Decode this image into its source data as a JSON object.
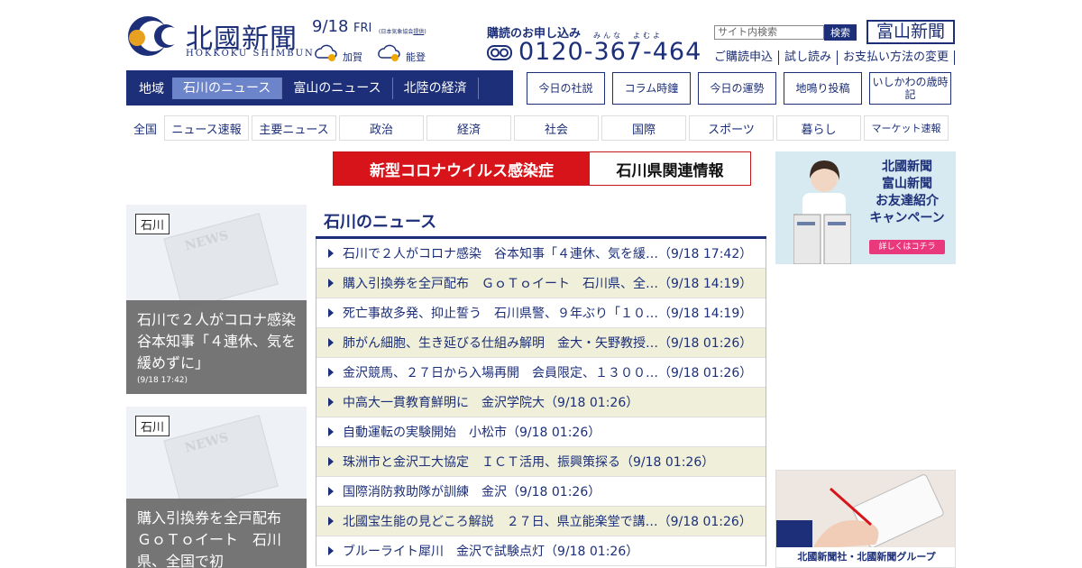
{
  "header": {
    "logo_jp": "北國新聞",
    "logo_en": "HOKKOKU SHIMBUN",
    "date": "9/18",
    "day_of_week": "FRI",
    "weather_source_prefix": "(日本気象協会",
    "weather_source_link": "提供",
    "weather_source_suffix": ")",
    "weather": [
      {
        "area": "加賀",
        "icon": "cloudy-sunny-icon"
      },
      {
        "area": "能登",
        "icon": "cloudy-sunny-icon"
      }
    ],
    "subscribe_title": "購読のお申し込み",
    "phone_ruby": "みんな　よむよ",
    "phone": "0120-367-464",
    "search_placeholder": "サイト内検索",
    "search_button": "検索",
    "toyama_logo": "富山新聞",
    "sublinks": [
      "ご購読申込",
      "試し読み",
      "お支払い方法の変更"
    ]
  },
  "region_nav": {
    "label": "地域",
    "tabs": [
      "石川のニュース",
      "富山のニュース",
      "北陸の経済"
    ],
    "active": 0
  },
  "feature_nav": [
    "今日の社説",
    "コラム時鐘",
    "今日の運勢",
    "地鳴り投稿",
    "いしかわの歳時記"
  ],
  "category_nav": {
    "label": "全国",
    "items": [
      "ニュース速報",
      "主要ニュース",
      "政治",
      "経済",
      "社会",
      "国際",
      "スポーツ",
      "暮らし",
      "マーケット速報"
    ]
  },
  "corona_banner": {
    "left": "新型コロナウイルス感染症",
    "right": "石川県関連情報"
  },
  "cards": [
    {
      "tag": "石川",
      "title": "石川で２人がコロナ感染　谷本知事「４連休、気を緩めずに」",
      "date": "(9/18 17:42)"
    },
    {
      "tag": "石川",
      "title": "購入引換券を全戸配布　ＧｏＴｏイート　石川県、全国で初",
      "date": ""
    }
  ],
  "card_watermark": "NEWS",
  "news_section": {
    "heading": "石川のニュース",
    "items": [
      "石川で２人がコロナ感染　谷本知事「４連休、気を緩…（9/18 17:42）",
      "購入引換券を全戸配布　ＧｏＴｏイート　石川県、全…（9/18 14:19）",
      "死亡事故多発、抑止誓う　石川県警、９年ぶり「１０…（9/18 14:19）",
      "肺がん細胞、生き延びる仕組み解明　金大・矢野教授…（9/18 01:26）",
      "金沢競馬、２７日から入場再開　会員限定、１３００…（9/18 01:26）",
      "中高大一貫教育鮮明に　金沢学院大（9/18 01:26）",
      "自動運転の実験開始　小松市（9/18 01:26）",
      "珠洲市と金沢工大協定　ＩＣＴ活用、振興策探る（9/18 01:26）",
      "国際消防救助隊が訓練　金沢（9/18 01:26）",
      "北國宝生能の見どころ解説　２７日、県立能楽堂で講…（9/18 01:26）",
      "ブルーライト犀川　金沢で試験点灯（9/18 01:26）"
    ]
  },
  "ads": {
    "campaign_line1": "北國新聞",
    "campaign_line2": "富山新聞",
    "campaign_line3": "お友達紹介",
    "campaign_line4": "キャンペーン",
    "campaign_button": "詳しくはコチラ",
    "group_footer": "北國新聞社・北國新聞グループ"
  },
  "colors": {
    "brand": "#1c2f78",
    "accent_red": "#d7141a",
    "alt_row": "#efefda"
  }
}
